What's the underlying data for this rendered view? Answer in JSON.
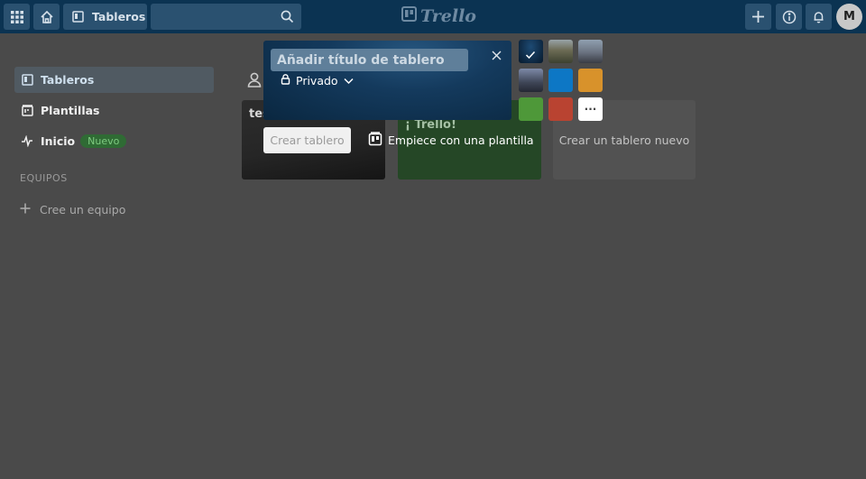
{
  "header": {
    "boards_label": "Tableros",
    "logo_text": "Trello",
    "avatar_initial": "M"
  },
  "sidebar": {
    "items": [
      {
        "label": "Tableros"
      },
      {
        "label": "Plantillas"
      },
      {
        "label": "Inicio",
        "badge": "Nuevo"
      }
    ],
    "section_label": "EQUIPOS",
    "create_team": "Cree un equipo"
  },
  "boards": {
    "tile1_title": "tes",
    "tile2_title": "¡ Trello!",
    "new_board": "Crear un tablero nuevo"
  },
  "create_board": {
    "title_placeholder": "Añadir título de tablero",
    "visibility": "Privado",
    "create_button": "Crear tablero",
    "template_link": "Empiece con una plantilla",
    "more_label": "···"
  },
  "colors": {
    "header_bg": "#0b3352",
    "page_bg": "#4a4a4a",
    "badge_green": "#2f6b34",
    "swatch_blue": "#0d77c5",
    "swatch_orange": "#d8922b",
    "swatch_green": "#4e9839",
    "swatch_red": "#b94331"
  }
}
